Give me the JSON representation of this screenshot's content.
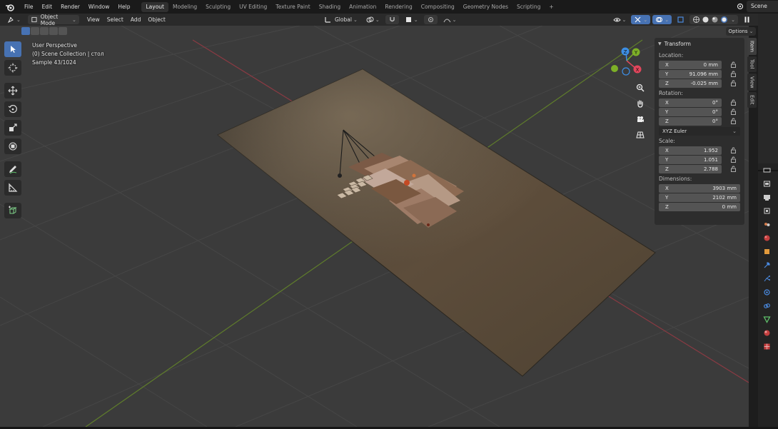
{
  "topbar": {
    "menu": [
      "File",
      "Edit",
      "Render",
      "Window",
      "Help"
    ],
    "workspace_tabs": [
      "Layout",
      "Modeling",
      "Sculpting",
      "UV Editing",
      "Texture Paint",
      "Shading",
      "Animation",
      "Rendering",
      "Compositing",
      "Geometry Nodes",
      "Scripting"
    ],
    "active_tab": "Layout",
    "add_tab": "+",
    "scene_label": "Scene"
  },
  "viewport_header": {
    "mode": "Object Mode",
    "menu": [
      "View",
      "Select",
      "Add",
      "Object"
    ],
    "transform_orientation": "Global"
  },
  "overlay": {
    "view_name": "User Perspective",
    "collection": "(0) Scene Collection | стол",
    "samples": "Sample 43/1024"
  },
  "options_label": "Options",
  "gizmo_axes": {
    "x": "X",
    "y": "Y",
    "z": "Z"
  },
  "npanel": {
    "title": "Transform",
    "location_label": "Location:",
    "location": [
      {
        "axis": "X",
        "value": "0 mm"
      },
      {
        "axis": "Y",
        "value": "91.096 mm"
      },
      {
        "axis": "Z",
        "value": "-0.025 mm"
      }
    ],
    "rotation_label": "Rotation:",
    "rotation": [
      {
        "axis": "X",
        "value": "0°"
      },
      {
        "axis": "Y",
        "value": "0°"
      },
      {
        "axis": "Z",
        "value": "0°"
      }
    ],
    "rotation_mode": "XYZ Euler",
    "scale_label": "Scale:",
    "scale": [
      {
        "axis": "X",
        "value": "1.952"
      },
      {
        "axis": "Y",
        "value": "1.051"
      },
      {
        "axis": "Z",
        "value": "2.788"
      }
    ],
    "dimensions_label": "Dimensions:",
    "dimensions": [
      {
        "axis": "X",
        "value": "3903 mm"
      },
      {
        "axis": "Y",
        "value": "2102 mm"
      },
      {
        "axis": "Z",
        "value": "0 mm"
      }
    ],
    "tabs": [
      "Item",
      "Tool",
      "View",
      "Edit"
    ],
    "active_tab": "Item"
  },
  "colors": {
    "accent": "#4772b3",
    "axis_x": "#e2465c",
    "axis_y": "#7db027",
    "axis_z": "#3d8ee5"
  }
}
